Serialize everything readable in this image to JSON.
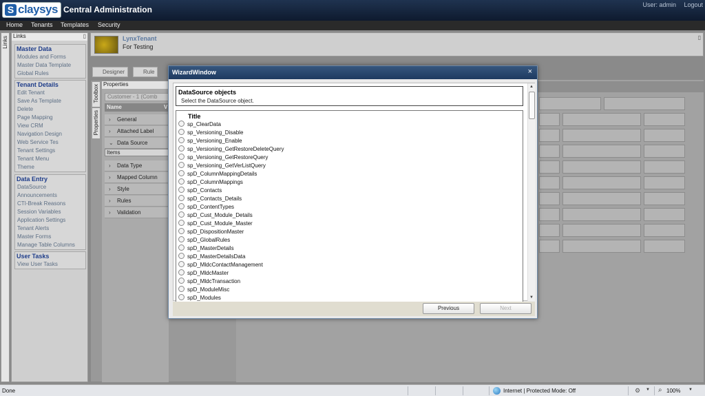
{
  "header": {
    "logo_text": "claysys",
    "app_title": "Central Administration",
    "user_label": "User: admin",
    "logout_label": "Logout"
  },
  "nav": [
    "Home",
    "Tenants",
    "Templates",
    "Security"
  ],
  "links_panel": {
    "strip_label": "Links",
    "title": "Links",
    "groups": [
      {
        "title": "Master Data",
        "items": [
          "Modules and Forms",
          "Master Data Template",
          "Global Rules"
        ]
      },
      {
        "title": "Tenant Details",
        "items": [
          "Edit Tenant",
          "Save As Template",
          "Delete",
          "Page Mapping",
          "View CRM",
          "Navigation Design",
          "Web Service Tes",
          "Tenant Settings",
          "Tenant Menu",
          "Theme"
        ]
      },
      {
        "title": "Data Entry",
        "items": [
          "DataSource",
          "Announcements",
          "CTI-Break Reasons",
          "Session Variables",
          "Application Settings",
          "Tenant Alerts",
          "Master Forms",
          "Manage Table Columns"
        ]
      },
      {
        "title": "User Tasks",
        "items": [
          "View User Tasks"
        ]
      }
    ]
  },
  "tenant": {
    "name": "LynxTenant",
    "description": "For Testing"
  },
  "toolbar": {
    "designer": "Designer",
    "rule": "Rule"
  },
  "side_tabs": {
    "toolbox": "Toolbox",
    "properties": "Properties"
  },
  "properties": {
    "title": "Properties",
    "combo_value": "Customer - 1 (Comb",
    "name_header": "Name",
    "value_header_initial": "V",
    "rows_top": [
      "General",
      "Attached Label",
      "Data Source"
    ],
    "items_label": "Items",
    "rows_bottom": [
      "Data Type",
      "Mapped Column",
      "Style",
      "Rules",
      "Validation"
    ]
  },
  "modal": {
    "title": "WizardWindow",
    "close": "×",
    "ds_title": "DataSource objects",
    "ds_desc": "Select the  DataSource object.",
    "list_title": "Title",
    "items": [
      "sp_ClearData",
      "sp_Versioning_Disable",
      "sp_Versioning_Enable",
      "sp_Versioning_GetRestoreDeleteQuery",
      "sp_Versioning_GetRestoreQuery",
      "sp_Versioning_GetVerListQuery",
      "spD_ColumnMappingDetails",
      "spD_ColumnMappings",
      "spD_Contacts",
      "spD_Contacts_Details",
      "spD_ContentTypes",
      "spD_Cust_Module_Details",
      "spD_Cust_Module_Master",
      "spD_DispositionMaster",
      "spD_GlobalRules",
      "spD_MasterDetails",
      "spD_MasterDetailsData",
      "spD_MldcContactManagement",
      "spD_MldcMaster",
      "spD_MldcTransaction",
      "spD_ModuleMisc",
      "spD_Modules"
    ],
    "previous": "Previous",
    "next": "Next"
  },
  "statusbar": {
    "status": "Done",
    "zone": "Internet | Protected Mode: Off",
    "zoom": "100%"
  },
  "colors": {
    "header": "#1f3350",
    "accent": "#1f3d8a",
    "modal_title": "#36567e"
  }
}
